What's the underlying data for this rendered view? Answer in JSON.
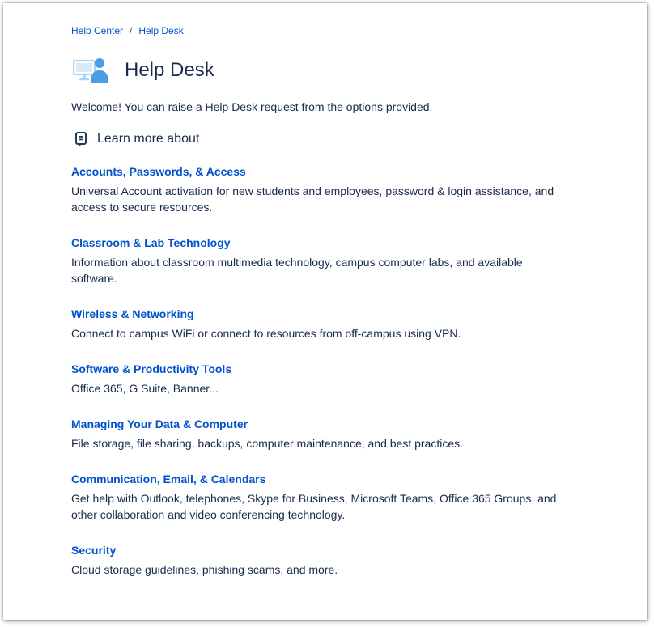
{
  "breadcrumb": {
    "items": [
      "Help Center",
      "Help Desk"
    ],
    "separator": "/"
  },
  "header": {
    "title": "Help Desk",
    "icon": "computer-user-icon"
  },
  "intro": "Welcome! You can raise a Help Desk request from the options provided.",
  "section": {
    "label": "Learn more about",
    "icon": "knowledge-base-icon"
  },
  "topics": [
    {
      "title": "Accounts, Passwords, & Access",
      "description": "Universal Account activation for new students and employees, password & login assistance, and access to secure resources."
    },
    {
      "title": "Classroom & Lab Technology",
      "description": "Information about classroom multimedia technology, campus computer labs, and available software."
    },
    {
      "title": "Wireless & Networking",
      "description": "Connect to campus WiFi or connect to resources from off-campus using VPN."
    },
    {
      "title": "Software & Productivity Tools",
      "description": "Office 365, G Suite, Banner..."
    },
    {
      "title": "Managing Your Data & Computer",
      "description": "File storage, file sharing, backups, computer maintenance, and best practices."
    },
    {
      "title": "Communication, Email, & Calendars",
      "description": "Get help with Outlook, telephones, Skype for Business, Microsoft Teams, Office 365 Groups, and other collaboration and video conferencing technology."
    },
    {
      "title": "Security",
      "description": "Cloud storage guidelines, phishing scams, and more."
    }
  ],
  "colors": {
    "link": "#0052cc",
    "text": "#172b4d",
    "icon_light": "#a8d4f5",
    "icon_dark": "#4a9ee8"
  }
}
